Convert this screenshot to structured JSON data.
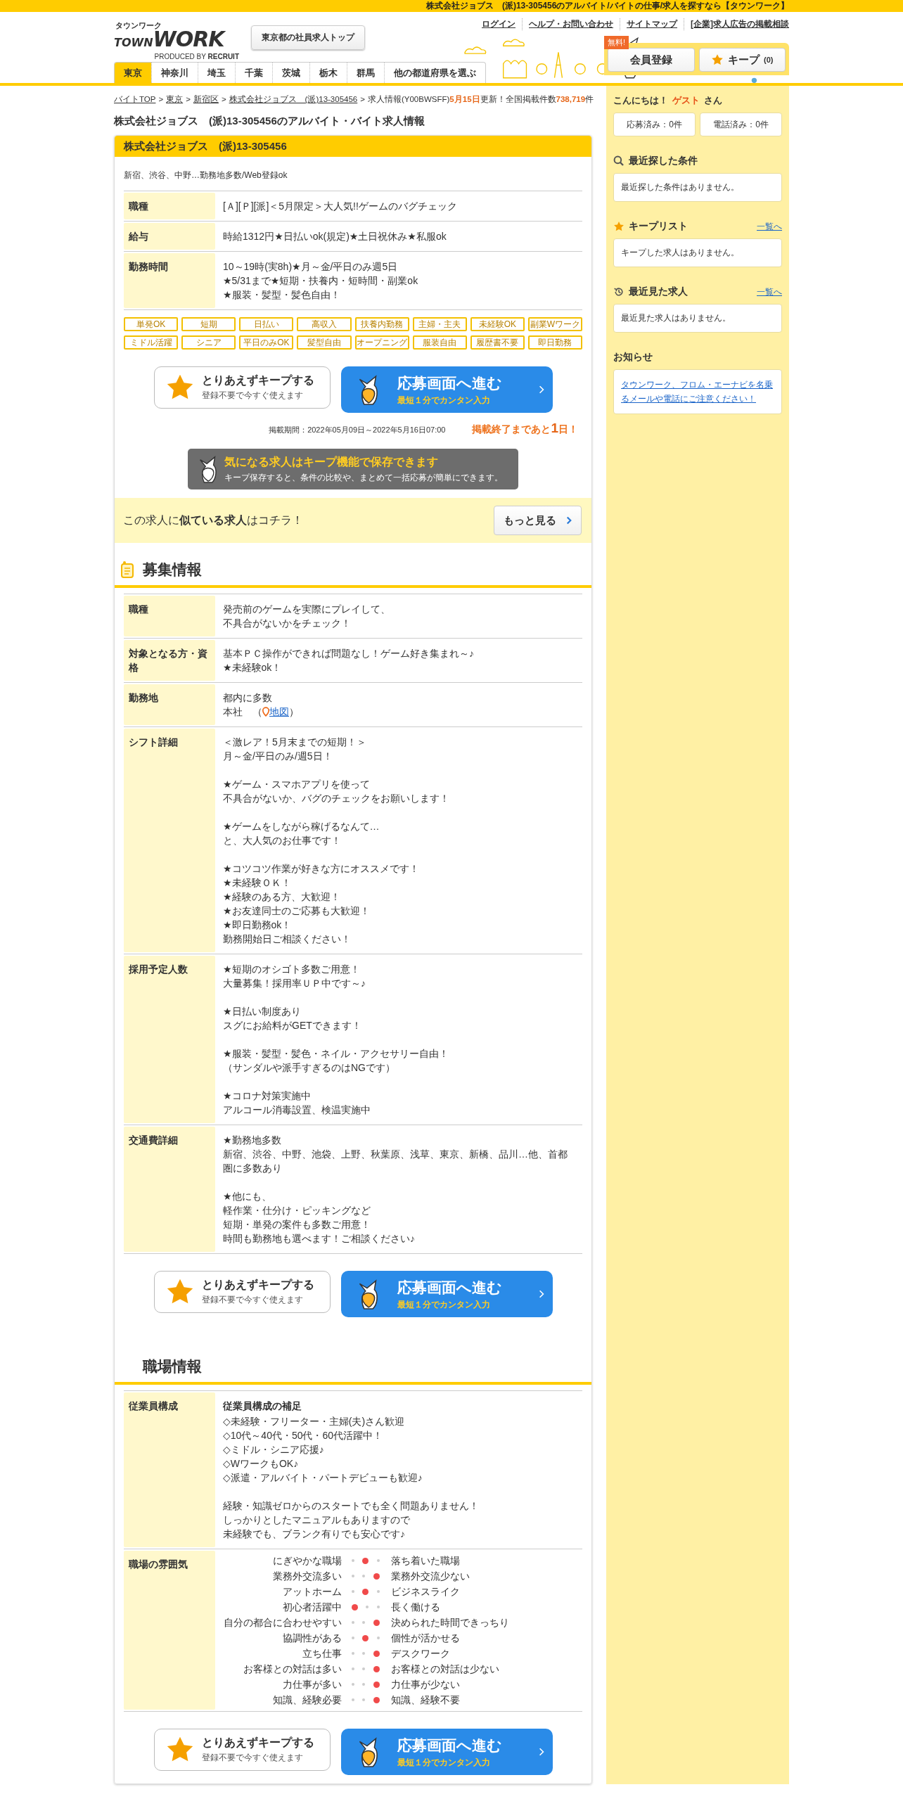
{
  "top_bar": "株式会社ジョブス　(派)13-305456のアルバイト/バイトの仕事/求人を探すなら【タウンワーク】",
  "logo": {
    "kana": "タウンワーク",
    "town": "TOWN",
    "work": "WORK",
    "produced": "PRODUCED BY",
    "brand": "RECRUIT"
  },
  "header_button": "東京都の社員求人トップ",
  "header_links": [
    "ログイン",
    "ヘルプ・お問い合わせ",
    "サイトマップ",
    "[企業]求人広告の掲載相談"
  ],
  "member": {
    "badge": "無料!",
    "register": "会員登録",
    "keep": "キープ",
    "keep_count": "(0)"
  },
  "nav_tabs": [
    {
      "label": "東京",
      "selected": true
    },
    {
      "label": "神奈川",
      "selected": false
    },
    {
      "label": "埼玉",
      "selected": false
    },
    {
      "label": "千葉",
      "selected": false
    },
    {
      "label": "茨城",
      "selected": false
    },
    {
      "label": "栃木",
      "selected": false
    },
    {
      "label": "群馬",
      "selected": false
    },
    {
      "label": "他の都道府県を選ぶ",
      "selected": false
    }
  ],
  "breadcrumb": {
    "links": [
      {
        "label": "バイトTOP",
        "separator": ">"
      },
      {
        "label": "東京",
        "separator": ">"
      },
      {
        "label": "新宿区",
        "separator": ">"
      },
      {
        "label": "株式会社ジョブス　(派)13-305456",
        "separator": ">"
      }
    ],
    "current": "求人情報(Y00BWSFF)",
    "update": "**5月15日**更新！全国掲載件数**738,719**件"
  },
  "page_title": "株式会社ジョブス　(派)13-305456のアルバイト・バイト求人情報",
  "job": {
    "company": "株式会社ジョブス　(派)13-305456",
    "catch": "新宿、渋谷、中野…勤務地多数/Web登録ok",
    "rows": [
      {
        "label": "職種",
        "paragraphs": [
          [
            "[Ａ][Ｐ][派]＜5月限定＞大人気!!ゲームのバグチェック"
          ]
        ]
      },
      {
        "label": "給与",
        "paragraphs": [
          [
            "時給1312円★日払いok(規定)★土日祝休み★私服ok"
          ]
        ]
      },
      {
        "label": "勤務時間",
        "paragraphs": [
          [
            "10～19時(実8h)★月～金/平日のみ週5日",
            "★5/31まで★短期・扶養内・短時間・副業ok",
            "★服装・髪型・髪色自由！"
          ]
        ]
      }
    ],
    "tags": [
      "単発OK",
      "短期",
      "日払い",
      "高収入",
      "扶養内勤務",
      "主婦・主夫",
      "未経験OK",
      "副業Wワーク",
      "ミドル活躍",
      "シニア",
      "平日のみOK",
      "髪型自由",
      "オープニング",
      "服装自由",
      "履歴書不要",
      "即日勤務"
    ],
    "cta": {
      "keep_title": "とりあえずキープする",
      "keep_sub": "登録不要で今すぐ使えます",
      "apply_title": "応募画面へ進む",
      "apply_sub": "最短１分でカンタン入力"
    },
    "period": "掲載期間：2022年05月09日～2022年5月16日07:00",
    "remaining": "掲載終了まであと**1**日！",
    "keep_banner": {
      "title": "気になる求人はキープ機能で保存できます",
      "text": "キープ保存すると、条件の比較や、まとめて一括応募が簡単にできます。"
    },
    "similar": {
      "text": "この求人に**似ている求人**はコチラ！",
      "button": "もっと見る"
    }
  },
  "recruit": {
    "heading": "募集情報",
    "rows": [
      {
        "label": "職種",
        "paragraphs": [
          [
            "発売前のゲームを実際にプレイして、",
            "不具合がないかをチェック！"
          ]
        ]
      },
      {
        "label": "対象となる方・資格",
        "paragraphs": [
          [
            "基本ＰＣ操作ができれば問題なし！ゲーム好き集まれ～♪",
            "★未経験ok！"
          ]
        ]
      },
      {
        "label": "勤務地",
        "paragraphs": [
          [
            "都内に多数"
          ]
        ],
        "map": {
          "prefix": "本社　（",
          "link": "地図",
          "suffix": "）"
        }
      },
      {
        "label": "シフト詳細",
        "paragraphs": [
          [
            "＜激レア！5月末までの短期！＞",
            "月～金/平日のみ/週5日！"
          ],
          [
            "★ゲーム・スマホアプリを使って",
            "不具合がないか、バグのチェックをお願いします！"
          ],
          [
            "★ゲームをしながら稼げるなんて…",
            "と、大人気のお仕事です！"
          ],
          [
            "★コツコツ作業が好きな方にオススメです！",
            "★未経験ＯＫ！",
            "★経験のある方、大歓迎！",
            "★お友達同士のご応募も大歓迎！",
            "★即日勤務ok！",
            "勤務開始日ご相談ください！"
          ]
        ]
      },
      {
        "label": "採用予定人数",
        "paragraphs": [
          [
            "★短期のオシゴト多数ご用意！",
            "大量募集！採用率ＵＰ中です～♪"
          ],
          [
            "★日払い制度あり",
            "スグにお給料がGETできます！"
          ],
          [
            "★服装・髪型・髪色・ネイル・アクセサリー自由！",
            "（サンダルや派手すぎるのはNGです）"
          ],
          [
            "★コロナ対策実施中",
            "アルコール消毒設置、検温実施中"
          ]
        ]
      },
      {
        "label": "交通費詳細",
        "paragraphs": [
          [
            "★勤務地多数",
            "新宿、渋谷、中野、池袋、上野、秋葉原、浅草、東京、新橋、品川…他、首都圏に多数あり"
          ],
          [
            "★他にも、",
            "軽作業・仕分け・ピッキングなど",
            "短期・単発の案件も多数ご用意！",
            "時間も勤務地も選べます！ご相談ください♪"
          ]
        ]
      }
    ],
    "cta": {
      "keep_title": "とりあえずキープする",
      "keep_sub": "登録不要で今すぐ使えます",
      "apply_title": "応募画面へ進む",
      "apply_sub": "最短１分でカンタン入力"
    }
  },
  "workplace": {
    "heading": "職場情報",
    "staff": {
      "label": "従業員構成",
      "subheading": "従業員構成の補足",
      "paragraphs": [
        [
          "◇未経験・フリーター・主婦(夫)さん歓迎",
          "◇10代～40代・50代・60代活躍中！",
          "◇ミドル・シニア応援♪",
          "◇WワークもOK♪",
          "◇派遣・アルバイト・パートデビューも歓迎♪"
        ],
        [
          "経験・知識ゼロからのスタートでも全く問題ありません！",
          "しっかりとしたマニュアルもありますので",
          "未経験でも、ブランク有りでも安心です♪"
        ]
      ]
    },
    "atmosphere": {
      "label": "職場の雰囲気",
      "rows": [
        {
          "left": "にぎやかな職場",
          "right": "落ち着いた職場",
          "dots": [
            {
              "selected": false
            },
            {
              "selected": true
            },
            {
              "selected": false
            }
          ]
        },
        {
          "left": "業務外交流多い",
          "right": "業務外交流少ない",
          "dots": [
            {
              "selected": false
            },
            {
              "selected": false
            },
            {
              "selected": true
            }
          ]
        },
        {
          "left": "アットホーム",
          "right": "ビジネスライク",
          "dots": [
            {
              "selected": false
            },
            {
              "selected": true
            },
            {
              "selected": false
            }
          ]
        },
        {
          "left": "初心者活躍中",
          "right": "長く働ける",
          "dots": [
            {
              "selected": true
            },
            {
              "selected": false
            },
            {
              "selected": false
            }
          ]
        },
        {
          "left": "自分の都合に合わせやすい",
          "right": "決められた時間できっちり",
          "dots": [
            {
              "selected": false
            },
            {
              "selected": false
            },
            {
              "selected": true
            }
          ]
        },
        {
          "left": "協調性がある",
          "right": "個性が活かせる",
          "dots": [
            {
              "selected": false
            },
            {
              "selected": true
            },
            {
              "selected": false
            }
          ]
        },
        {
          "left": "立ち仕事",
          "right": "デスクワーク",
          "dots": [
            {
              "selected": false
            },
            {
              "selected": false
            },
            {
              "selected": true
            }
          ]
        },
        {
          "left": "お客様との対話は多い",
          "right": "お客様との対話は少ない",
          "dots": [
            {
              "selected": false
            },
            {
              "selected": false
            },
            {
              "selected": true
            }
          ]
        },
        {
          "left": "力仕事が多い",
          "right": "力仕事が少ない",
          "dots": [
            {
              "selected": false
            },
            {
              "selected": false
            },
            {
              "selected": true
            }
          ]
        },
        {
          "left": "知識、経験必要",
          "right": "知識、経験不要",
          "dots": [
            {
              "selected": false
            },
            {
              "selected": false
            },
            {
              "selected": true
            }
          ]
        }
      ]
    },
    "cta": {
      "keep_title": "とりあえずキープする",
      "keep_sub": "登録不要で今すぐ使えます",
      "apply_title": "応募画面へ進む",
      "apply_sub": "最短１分でカンタン入力"
    }
  },
  "sidebar": {
    "greeting": "こんにちは！",
    "user": "ゲスト",
    "suffix": "さん",
    "counters": [
      "応募済み：0件",
      "電話済み：0件"
    ],
    "sections": [
      {
        "kind": "search",
        "title": "最近探した条件",
        "empty": "最近探した条件はありません。"
      },
      {
        "kind": "star",
        "title": "キープリスト",
        "link": "一覧へ",
        "empty": "キープした求人はありません。"
      },
      {
        "kind": "history",
        "title": "最近見た求人",
        "link": "一覧へ",
        "empty": "最近見た求人はありません。"
      }
    ],
    "notice": {
      "title": "お知らせ",
      "link": "タウンワーク、フロム・エーナビを名乗るメールや電話にご注意ください！"
    }
  }
}
